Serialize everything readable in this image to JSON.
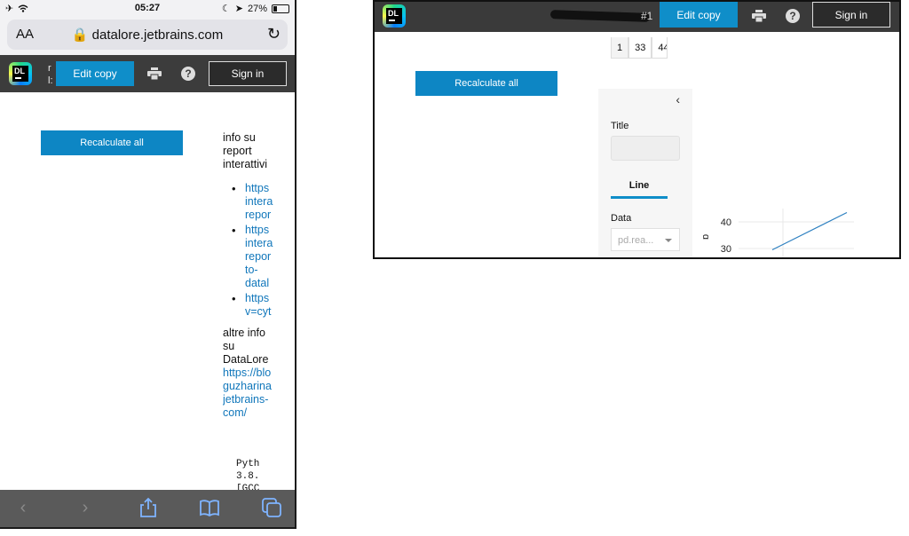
{
  "phone": {
    "status": {
      "time": "05:27",
      "battery": "27%"
    },
    "safari": {
      "text_size": "AA",
      "url": "datalore.jetbrains.com"
    },
    "toolbar": {
      "logo": "DL",
      "title_line1": "r",
      "title_line2": "l:",
      "edit_copy": "Edit copy",
      "sign_in": "Sign in"
    },
    "recalculate": "Recalculate all",
    "report_info": [
      "info su",
      "report",
      "interattivi"
    ],
    "links": [
      [
        "https",
        "intera",
        "repor"
      ],
      [
        "https",
        "intera",
        "repor",
        "to-",
        "datal"
      ],
      [
        "https",
        "v=cyt"
      ]
    ],
    "more_info": [
      "altre info",
      "su",
      "DataLore"
    ],
    "more_link": [
      "https://blo",
      "guzharina",
      "jetbrains-",
      "com/"
    ],
    "python": [
      "Pyth",
      "3.8.",
      "[GCC"
    ],
    "icons": {
      "back": "chevron-left-icon",
      "forward": "chevron-right-icon",
      "share": "share-icon",
      "bookmarks": "book-icon",
      "tabs": "tabs-icon"
    }
  },
  "desktop": {
    "toolbar": {
      "logo": "DL",
      "title_suffix": "#1",
      "edit_copy": "Edit copy",
      "sign_in": "Sign in"
    },
    "table_row": {
      "index": "1",
      "cell1": "33",
      "cell2": "44"
    },
    "recalculate": "Recalculate all",
    "panel": {
      "title_label": "Title",
      "tab": "Line",
      "data_label": "Data",
      "data_select": "pd.rea..."
    }
  },
  "chart_data": {
    "type": "line",
    "ylabel": "b",
    "yticks": [
      40,
      30
    ],
    "series": [
      {
        "x": [
          0,
          1
        ],
        "values": [
          29.5,
          43.5
        ]
      }
    ]
  }
}
